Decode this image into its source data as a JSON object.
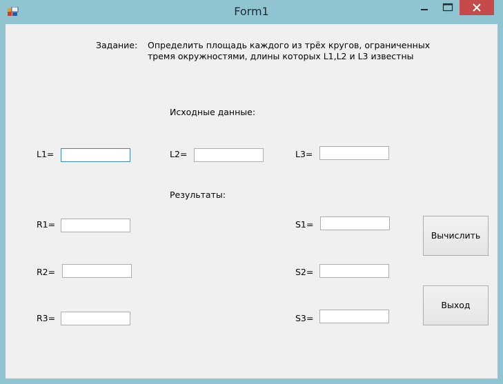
{
  "window": {
    "title": "Form1"
  },
  "task": {
    "label": "Задание:",
    "line1": "Определить площадь каждого из трёх кругов, ограниченных",
    "line2": "тремя окружностями, длины которых L1,L2 и L3 известны"
  },
  "inputs": {
    "heading": "Исходные данные:",
    "l1": {
      "label": "L1=",
      "value": ""
    },
    "l2": {
      "label": "L2=",
      "value": ""
    },
    "l3": {
      "label": "L3=",
      "value": ""
    }
  },
  "results": {
    "heading": "Результаты:",
    "r1": {
      "label": "R1=",
      "value": ""
    },
    "r2": {
      "label": "R2=",
      "value": ""
    },
    "r3": {
      "label": "R3=",
      "value": ""
    },
    "s1": {
      "label": "S1=",
      "value": ""
    },
    "s2": {
      "label": "S2=",
      "value": ""
    },
    "s3": {
      "label": "S3=",
      "value": ""
    }
  },
  "buttons": {
    "calculate": "Вычислить",
    "exit": "Выход"
  },
  "colors": {
    "frame": "#90c4d1",
    "client": "#f0f0f0",
    "close_button": "#c74a4a",
    "focus_border": "#3a86c8"
  },
  "icons": {
    "app": "winforms-app-icon",
    "minimize": "minimize-icon",
    "maximize": "maximize-icon",
    "close": "close-icon"
  }
}
